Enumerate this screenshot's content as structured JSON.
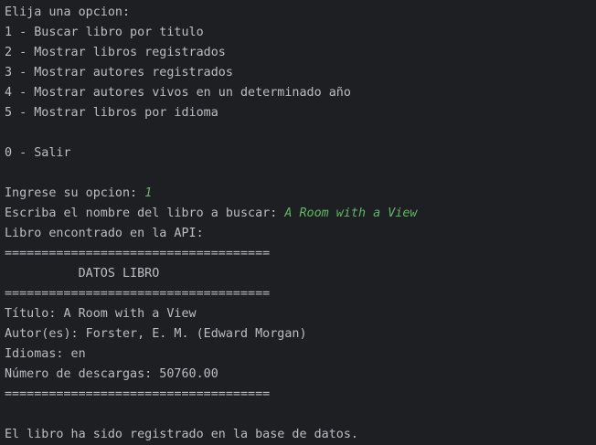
{
  "console": {
    "menu": {
      "prompt": "Elija una opcion:",
      "options": [
        "1 - Buscar libro por titulo",
        "2 - Mostrar libros registrados",
        "3 - Mostrar autores registrados",
        "4 - Mostrar autores vivos en un determinado año",
        "5 - Mostrar libros por idioma"
      ],
      "exit_option": "0 - Salir"
    },
    "option_prompt": "Ingrese su opcion: ",
    "option_input": "1",
    "title_prompt": "Escriba el nombre del libro a buscar: ",
    "title_input": "A Room with a View",
    "found_msg": "Libro encontrado en la API:",
    "separator": "====================================",
    "header": "          DATOS LIBRO",
    "book": {
      "title_line": "Título: A Room with a View",
      "author_line": "Autor(es): Forster, E. M. (Edward Morgan)",
      "language_line": "Idiomas: en",
      "downloads_line": "Número de descargas: 50760.00"
    },
    "saved_msg": "El libro ha sido registrado en la base de datos."
  },
  "colors": {
    "background": "#1e1f22",
    "text": "#bcbec4",
    "user_input": "#5fb865"
  }
}
